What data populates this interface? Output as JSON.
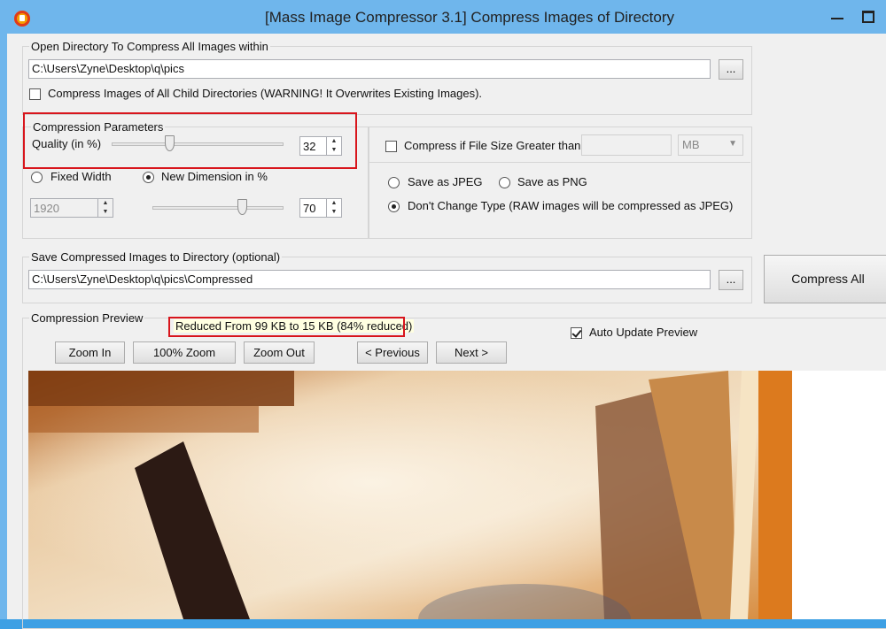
{
  "window": {
    "title": "[Mass Image Compressor 3.1] Compress Images of Directory",
    "app_icon": "app-logo-icon",
    "controls": [
      "minimize-icon",
      "maximize-icon"
    ]
  },
  "open_dir": {
    "group_label": "Open Directory To Compress All Images within",
    "path": "C:\\Users\\Zyne\\Desktop\\q\\pics",
    "browse_label": "...",
    "child_dirs_label": "Compress Images of All Child Directories (WARNING! It Overwrites Existing Images).",
    "child_dirs_checked": false
  },
  "compression": {
    "group_label": "Compression Parameters",
    "quality_label": "Quality (in %)",
    "quality_value": "32",
    "quality_fraction": 0.32,
    "fixed_width_label": "Fixed Width",
    "fixed_width_checked": false,
    "new_dim_label": "New Dimension in %",
    "new_dim_checked": true,
    "width_value": "1920",
    "dim_value": "70",
    "dim_fraction": 0.7
  },
  "size_filter": {
    "label": "Compress if File Size Greater than",
    "checked": false,
    "value": "",
    "unit": "MB"
  },
  "format": {
    "jpeg_label": "Save as JPEG",
    "png_label": "Save as PNG",
    "keep_label": "Don't Change Type (RAW images will be compressed as JPEG)",
    "selected": "keep"
  },
  "save_dir": {
    "group_label": "Save Compressed Images to Directory (optional)",
    "path": "C:\\Users\\Zyne\\Desktop\\q\\pics\\Compressed",
    "browse_label": "..."
  },
  "compress_all_label": "Compress All",
  "preview": {
    "group_label": "Compression Preview",
    "reduced_text": "Reduced From 99 KB to 15 KB (84% reduced)",
    "auto_update_label": "Auto Update Preview",
    "auto_update_checked": true,
    "zoom_in": "Zoom In",
    "zoom_100": "100% Zoom",
    "zoom_out": "Zoom Out",
    "previous": "< Previous",
    "next": "Next >"
  },
  "colors": {
    "highlight": "#d8151c",
    "window_frame": "#6fb6ec",
    "dialog_bg": "#f0f0f0"
  }
}
